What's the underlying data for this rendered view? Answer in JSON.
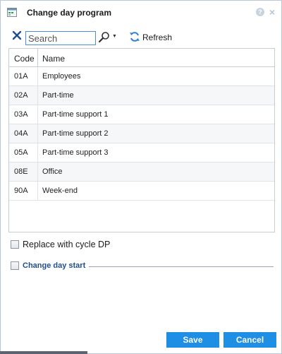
{
  "dialog": {
    "title": "Change day program",
    "help_glyph": "?",
    "close_glyph": "×"
  },
  "toolbar": {
    "search_placeholder": "Search",
    "search_value": "",
    "refresh_label": "Refresh"
  },
  "grid": {
    "columns": [
      "Code",
      "Name"
    ],
    "rows": [
      {
        "code": "01A",
        "name": "Employees"
      },
      {
        "code": "02A",
        "name": "Part-time"
      },
      {
        "code": "03A",
        "name": "Part-time support 1"
      },
      {
        "code": "04A",
        "name": "Part-time support 2"
      },
      {
        "code": "05A",
        "name": "Part-time support 3"
      },
      {
        "code": "08E",
        "name": "Office"
      },
      {
        "code": "90A",
        "name": "Week-end"
      }
    ]
  },
  "options": {
    "replace_with_cycle_label": "Replace with cycle DP",
    "replace_with_cycle_checked": false,
    "change_day_start_label": "Change day start",
    "change_day_start_checked": false
  },
  "footer": {
    "save_label": "Save",
    "cancel_label": "Cancel"
  },
  "colors": {
    "accent": "#1f8fe5",
    "link": "#1f4e8c"
  }
}
